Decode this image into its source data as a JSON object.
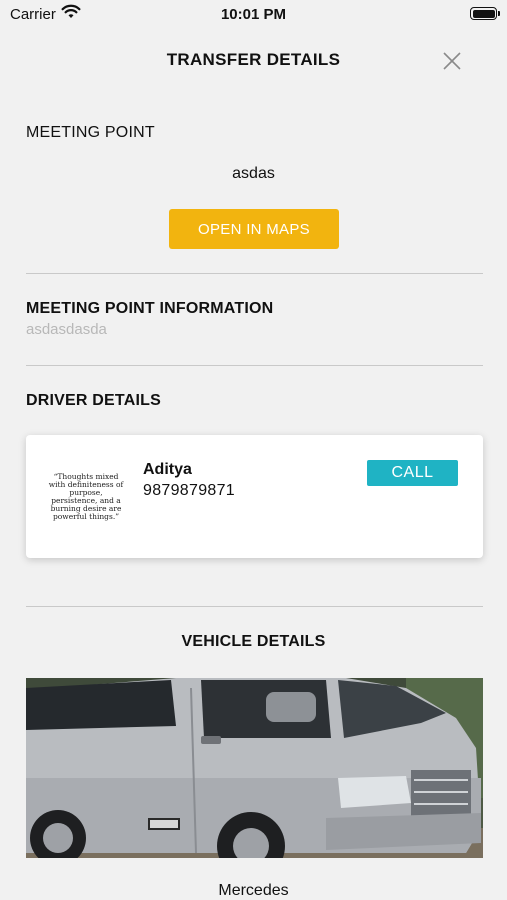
{
  "status_bar": {
    "carrier": "Carrier",
    "time": "10:01 PM"
  },
  "header": {
    "title": "TRANSFER DETAILS"
  },
  "meeting_point": {
    "label": "MEETING POINT",
    "value": "asdas",
    "open_maps_label": "OPEN IN MAPS"
  },
  "meeting_info": {
    "title": "MEETING POINT INFORMATION",
    "text": "asdasdasda"
  },
  "driver": {
    "section_title": "DRIVER DETAILS",
    "avatar_quote": "“Thoughts mixed with definiteness of purpose, persistence, and a burning desire are powerful things.”",
    "name": "Aditya",
    "phone": "9879879871",
    "call_label": "CALL"
  },
  "vehicle": {
    "section_title": "VEHICLE DETAILS",
    "name": "Mercedes"
  },
  "colors": {
    "maps_button": "#f2b40f",
    "call_button": "#1fb3c4",
    "background": "#f1f1f1"
  }
}
